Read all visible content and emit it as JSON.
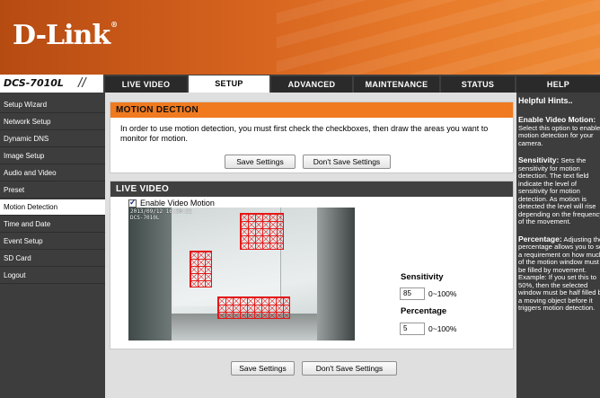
{
  "brand": {
    "logo": "D-Link",
    "reg_mark": "®",
    "model": "DCS-7010L"
  },
  "nav": {
    "tabs": [
      {
        "label": "LIVE VIDEO"
      },
      {
        "label": "SETUP"
      },
      {
        "label": "ADVANCED"
      },
      {
        "label": "MAINTENANCE"
      },
      {
        "label": "STATUS"
      },
      {
        "label": "HELP"
      }
    ],
    "active_tab": "SETUP"
  },
  "sidebar": {
    "items": [
      {
        "label": "Setup Wizard"
      },
      {
        "label": "Network Setup"
      },
      {
        "label": "Dynamic DNS"
      },
      {
        "label": "Image Setup"
      },
      {
        "label": "Audio and Video"
      },
      {
        "label": "Preset"
      },
      {
        "label": "Motion Detection"
      },
      {
        "label": "Time and Date"
      },
      {
        "label": "Event Setup"
      },
      {
        "label": "SD Card"
      },
      {
        "label": "Logout"
      }
    ],
    "active_item": "Motion Detection"
  },
  "motion": {
    "title": "MOTION DECTION",
    "description": "In order to use motion detection, you must first check the checkboxes, then draw the areas you want to monitor for motion.",
    "save_label": "Save Settings",
    "dont_save_label": "Don't Save Settings"
  },
  "live": {
    "title": "LIVE VIDEO",
    "enable_label": "Enable Video Motion",
    "enable_checked": true,
    "overlay_line1": "2013/09/12 16:30:21",
    "overlay_line2": "DCS-7010L",
    "sensitivity_label": "Sensitivity",
    "sensitivity_value": "85",
    "sensitivity_range": "0~100%",
    "percentage_label": "Percentage",
    "percentage_value": "5",
    "percentage_range": "0~100%"
  },
  "bottom": {
    "save_label": "Save Settings",
    "dont_save_label": "Don't Save Settings"
  },
  "help": {
    "title": "Helpful Hints..",
    "sections": [
      {
        "heading": "Enable Video Motion:",
        "text": "Select this option to enable motion detection for your camera."
      },
      {
        "heading": "Sensitivity:",
        "text": "Sets the sensitivity for motion detection. The text field indicate the level of sensitivity for motion detection. As motion is detected the level will rise depending on the frequency of the movement."
      },
      {
        "heading": "Percentage:",
        "text": "Adjusting the percentage allows you to set a requirement on how much of the motion window must be filled by movement. Example: If you set this to 50%, then the selected window must be half filled by a moving object before it triggers motion detection."
      }
    ]
  },
  "colors": {
    "accent_orange": "#f07a1f",
    "header_orange": "#d5621e",
    "dark_panel": "#3d3d3d",
    "grid_red": "#e21616"
  }
}
